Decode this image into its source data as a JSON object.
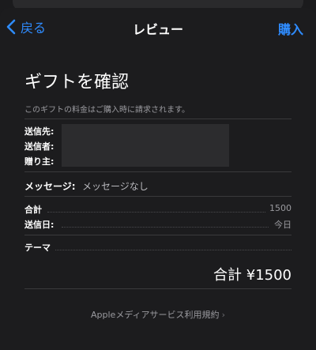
{
  "nav": {
    "back_label": "戻る",
    "title": "レビュー",
    "buy_label": "購入"
  },
  "gift": {
    "heading": "ギフトを確認",
    "notice": "このギフトの料金はご購入時に請求されます。",
    "recipient_label": "送信先:",
    "sender_label": "送信者:",
    "giver_label": "贈り主:",
    "message_label": "メッセージ:",
    "message_value": "メッセージなし",
    "subtotal_label": "合計",
    "subtotal_value": "1500",
    "send_date_label": "送信日:",
    "send_date_value": "今日",
    "theme_label": "テーマ",
    "total": "合計 ¥1500"
  },
  "footer": {
    "terms_link": "Appleメディアサービス利用規約"
  },
  "colors": {
    "accent": "#2f8cff",
    "background": "#1c1c1e"
  },
  "icons": {
    "back": "chevron-left-icon",
    "terms": "chevron-right-icon"
  }
}
